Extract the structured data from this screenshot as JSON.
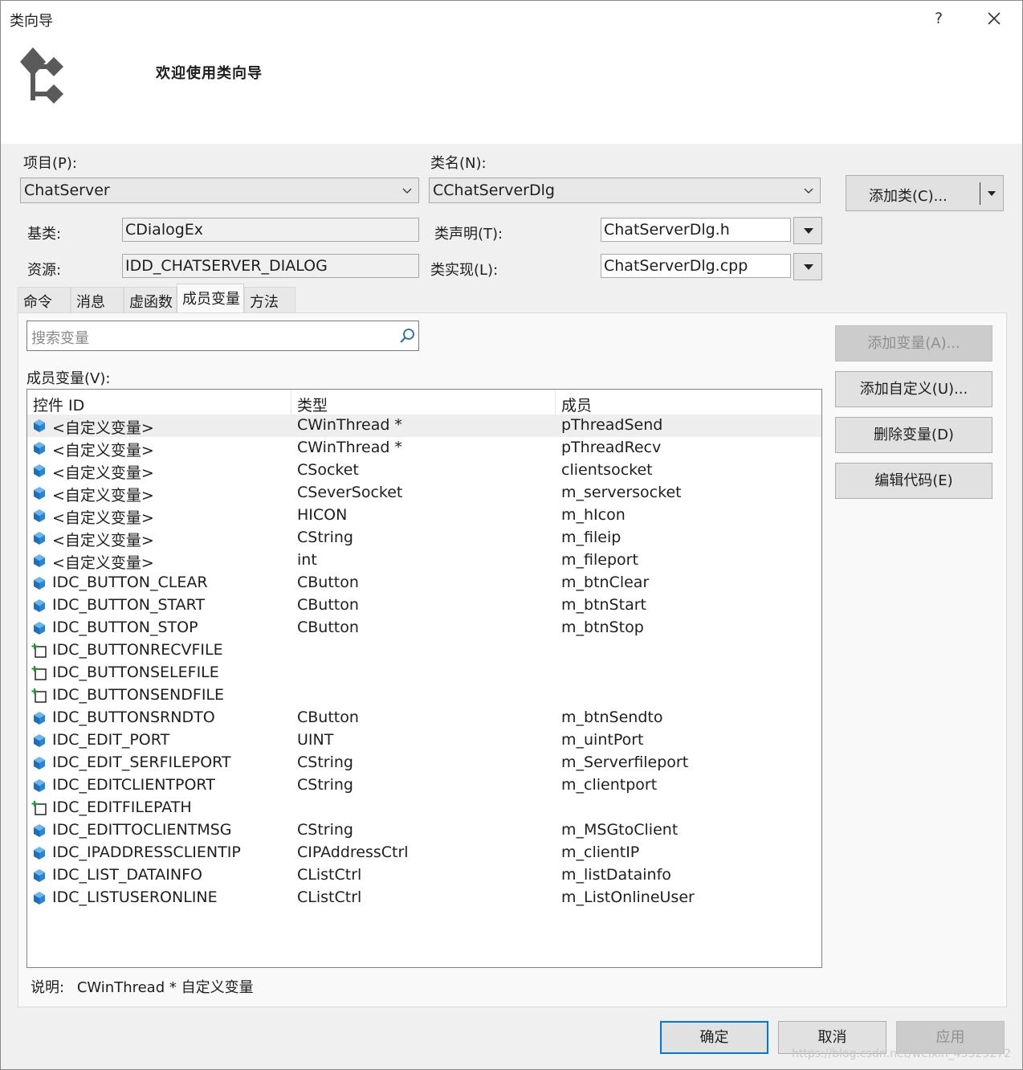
{
  "window": {
    "title": "类向导",
    "help_label": "?",
    "banner_text": "欢迎使用类向导"
  },
  "top": {
    "project_label": "项目(P):",
    "project_value": "ChatServer",
    "classname_label": "类名(N):",
    "classname_value": "CChatServerDlg",
    "add_class_label": "添加类(C)...",
    "base_label": "基类:",
    "base_value": "CDialogEx",
    "resource_label": "资源:",
    "resource_value": "IDD_CHATSERVER_DIALOG",
    "decl_label": "类声明(T):",
    "decl_value": "ChatServerDlg.h",
    "impl_label": "类实现(L):",
    "impl_value": "ChatServerDlg.cpp"
  },
  "tabs": [
    {
      "label": "命令"
    },
    {
      "label": "消息"
    },
    {
      "label": "虚函数"
    },
    {
      "label": "成员变量"
    },
    {
      "label": "方法"
    }
  ],
  "members": {
    "search_placeholder": "搜索变量",
    "list_label": "成员变量(V):",
    "columns": [
      "控件 ID",
      "类型",
      "成员"
    ],
    "rows": [
      {
        "id": "<自定义变量>",
        "type": "CWinThread *",
        "member": "pThreadSend",
        "icon": "custom-variable-icon",
        "selected": true
      },
      {
        "id": "<自定义变量>",
        "type": "CWinThread *",
        "member": "pThreadRecv",
        "icon": "custom-variable-icon"
      },
      {
        "id": "<自定义变量>",
        "type": "CSocket",
        "member": "clientsocket",
        "icon": "custom-variable-icon"
      },
      {
        "id": "<自定义变量>",
        "type": "CSeverSocket",
        "member": "m_serversocket",
        "icon": "custom-variable-icon"
      },
      {
        "id": "<自定义变量>",
        "type": "HICON",
        "member": "m_hIcon",
        "icon": "custom-variable-icon"
      },
      {
        "id": "<自定义变量>",
        "type": "CString",
        "member": "m_fileip",
        "icon": "custom-variable-icon"
      },
      {
        "id": "<自定义变量>",
        "type": "int",
        "member": "m_fileport",
        "icon": "custom-variable-icon"
      },
      {
        "id": "IDC_BUTTON_CLEAR",
        "type": "CButton",
        "member": "m_btnClear",
        "icon": "variable-icon"
      },
      {
        "id": "IDC_BUTTON_START",
        "type": "CButton",
        "member": "m_btnStart",
        "icon": "variable-icon"
      },
      {
        "id": "IDC_BUTTON_STOP",
        "type": "CButton",
        "member": "m_btnStop",
        "icon": "variable-icon"
      },
      {
        "id": "IDC_BUTTONRECVFILE",
        "type": "",
        "member": "",
        "icon": "control-icon"
      },
      {
        "id": "IDC_BUTTONSELEFILE",
        "type": "",
        "member": "",
        "icon": "control-icon"
      },
      {
        "id": "IDC_BUTTONSENDFILE",
        "type": "",
        "member": "",
        "icon": "control-icon"
      },
      {
        "id": "IDC_BUTTONSRNDTO",
        "type": "CButton",
        "member": "m_btnSendto",
        "icon": "variable-icon"
      },
      {
        "id": "IDC_EDIT_PORT",
        "type": "UINT",
        "member": "m_uintPort",
        "icon": "variable-icon"
      },
      {
        "id": "IDC_EDIT_SERFILEPORT",
        "type": "CString",
        "member": "m_Serverfileport",
        "icon": "variable-icon"
      },
      {
        "id": "IDC_EDITCLIENTPORT",
        "type": "CString",
        "member": "m_clientport",
        "icon": "variable-icon"
      },
      {
        "id": "IDC_EDITFILEPATH",
        "type": "",
        "member": "",
        "icon": "control-icon"
      },
      {
        "id": "IDC_EDITTOCLIENTMSG",
        "type": "CString",
        "member": "m_MSGtoClient",
        "icon": "variable-icon"
      },
      {
        "id": "IDC_IPADDRESSCLIENTIP",
        "type": "CIPAddressCtrl",
        "member": "m_clientIP",
        "icon": "variable-icon"
      },
      {
        "id": "IDC_LIST_DATAINFO",
        "type": "CListCtrl",
        "member": "m_listDatainfo",
        "icon": "variable-icon"
      },
      {
        "id": "IDC_LISTUSERONLINE",
        "type": "CListCtrl",
        "member": "m_ListOnlineUser",
        "icon": "variable-icon"
      }
    ],
    "description_label": "说明:",
    "description_value": "CWinThread * 自定义变量"
  },
  "side_buttons": {
    "add_variable": "添加变量(A)...",
    "add_custom": "添加自定义(U)...",
    "delete_variable": "删除变量(D)",
    "edit_code": "编辑代码(E)"
  },
  "footer": {
    "ok": "确定",
    "cancel": "取消",
    "apply": "应用",
    "watermark": "https://blog.csdn.net/weixin_45525272"
  },
  "colors": {
    "panel_bg": "#f0f0f0",
    "accent": "#0078d7",
    "icon_blue": "#1f7fc4"
  }
}
